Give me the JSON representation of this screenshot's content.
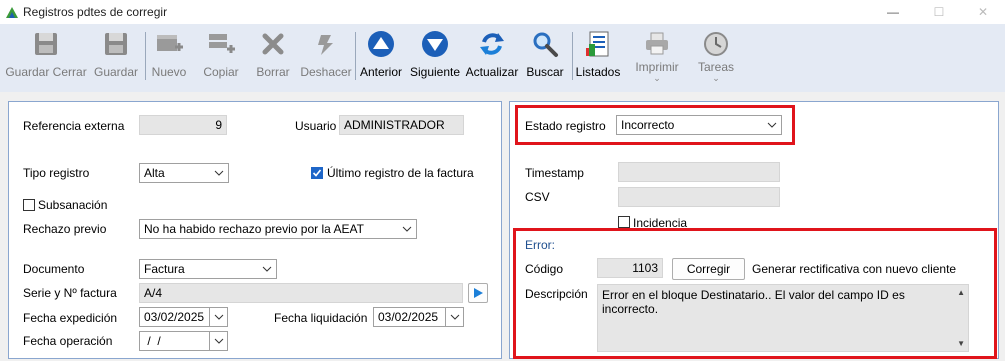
{
  "window": {
    "title": "Registros pdtes de corregir",
    "minimize": "—",
    "maximize": "☐",
    "close": "✕"
  },
  "toolbar": {
    "guardar_cerrar": "Guardar Cerrar",
    "guardar": "Guardar",
    "nuevo": "Nuevo",
    "copiar": "Copiar",
    "borrar": "Borrar",
    "deshacer": "Deshacer",
    "anterior": "Anterior",
    "siguiente": "Siguiente",
    "actualizar": "Actualizar",
    "buscar": "Buscar",
    "listados": "Listados",
    "imprimir": "Imprimir",
    "tareas": "Tareas"
  },
  "left": {
    "referencia_externa_label": "Referencia externa",
    "referencia_externa_value": "9",
    "usuario_label": "Usuario",
    "usuario_value": "ADMINISTRADOR",
    "tipo_registro_label": "Tipo registro",
    "tipo_registro_value": "Alta",
    "ultimo_registro_label": "Último registro de la factura",
    "ultimo_registro_checked": true,
    "subsanacion_label": "Subsanación",
    "subsanacion_checked": false,
    "rechazo_previo_label": "Rechazo previo",
    "rechazo_previo_value": "No ha habido rechazo previo por la AEAT",
    "documento_label": "Documento",
    "documento_value": "Factura",
    "serie_label": "Serie y Nº factura",
    "serie_value": "A/4",
    "fecha_expedicion_label": "Fecha expedición",
    "fecha_expedicion_value": "03/02/2025",
    "fecha_liquidacion_label": "Fecha liquidación",
    "fecha_liquidacion_value": "03/02/2025",
    "fecha_operacion_label": "Fecha operación",
    "fecha_operacion_value": " /  /"
  },
  "right": {
    "estado_registro_label": "Estado registro",
    "estado_registro_value": "Incorrecto",
    "timestamp_label": "Timestamp",
    "timestamp_value": "",
    "csv_label": "CSV",
    "csv_value": "",
    "incidencia_label": "Incidencia",
    "incidencia_checked": false,
    "error_section_label": "Error:",
    "codigo_label": "Código",
    "codigo_value": "1103",
    "corregir_button": "Corregir",
    "generar_label": "Generar rectificativa con nuevo cliente",
    "descripcion_label": "Descripción",
    "descripcion_value": "Error en el bloque Destinatario.. El valor del campo ID es incorrecto."
  },
  "colors": {
    "toolbar_bg": "#e4eaf4",
    "panel_border": "#8aa6cf",
    "highlight_red": "#e0141b",
    "nav_blue": "#1c5fb8",
    "check_blue": "#1e66c8"
  }
}
